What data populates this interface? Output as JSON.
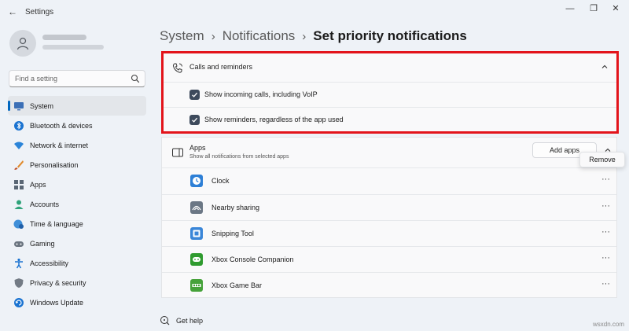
{
  "window": {
    "title": "Settings",
    "back_glyph": "←",
    "min_glyph": "—",
    "max_glyph": "❐",
    "close_glyph": "✕"
  },
  "search": {
    "placeholder": "Find a setting",
    "icon": "search-icon"
  },
  "sidebar": {
    "items": [
      {
        "label": "System",
        "icon": "monitor-icon",
        "active": true
      },
      {
        "label": "Bluetooth & devices",
        "icon": "bluetooth-icon"
      },
      {
        "label": "Network & internet",
        "icon": "wifi-icon"
      },
      {
        "label": "Personalisation",
        "icon": "brush-icon"
      },
      {
        "label": "Apps",
        "icon": "apps-icon"
      },
      {
        "label": "Accounts",
        "icon": "person-icon"
      },
      {
        "label": "Time & language",
        "icon": "globe-clock-icon"
      },
      {
        "label": "Gaming",
        "icon": "gamepad-icon"
      },
      {
        "label": "Accessibility",
        "icon": "accessibility-icon"
      },
      {
        "label": "Privacy & security",
        "icon": "shield-icon"
      },
      {
        "label": "Windows Update",
        "icon": "update-icon"
      }
    ]
  },
  "breadcrumb": {
    "items": [
      "System",
      "Notifications",
      "Set priority notifications"
    ],
    "separator": "›"
  },
  "calls_card": {
    "title": "Calls and reminders",
    "icon": "phone-icon",
    "options": [
      {
        "label": "Show incoming calls, including VoIP",
        "checked": true
      },
      {
        "label": "Show reminders, regardless of the app used",
        "checked": true
      }
    ]
  },
  "apps_card": {
    "title": "Apps",
    "subtitle": "Show all notifications from selected apps",
    "add_button": "Add apps",
    "more_glyph": "···",
    "apps": [
      {
        "name": "Clock",
        "icon": "clock-icon",
        "color": "#2d7fd6"
      },
      {
        "name": "Nearby sharing",
        "icon": "nearby-sharing-icon",
        "color": "#6b7785"
      },
      {
        "name": "Snipping Tool",
        "icon": "snipping-tool-icon",
        "color": "#3a86d8"
      },
      {
        "name": "Xbox Console Companion",
        "icon": "xbox-icon",
        "color": "#2f9b2f"
      },
      {
        "name": "Xbox Game Bar",
        "icon": "xbox-game-bar-icon",
        "color": "#46a23a"
      }
    ]
  },
  "context_menu": {
    "remove_label": "Remove"
  },
  "help": {
    "label": "Get help"
  },
  "watermark": "wsxdn.com",
  "colors": {
    "accent": "#0067c0",
    "highlight": "#e3141b",
    "checkbox": "#3d4a5c"
  }
}
